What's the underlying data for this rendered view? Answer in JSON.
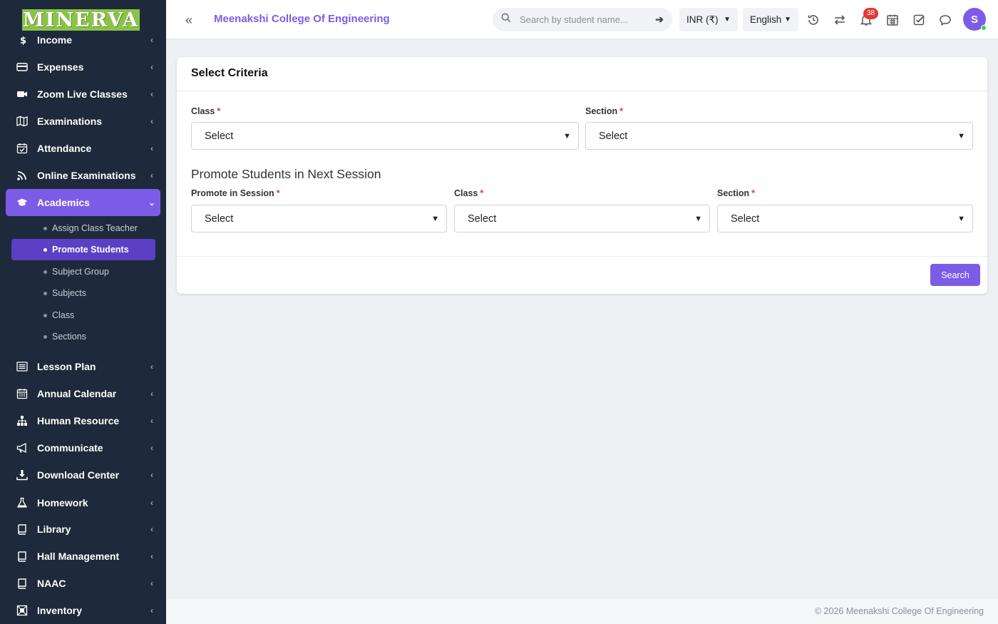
{
  "brand": {
    "logo_text": "MINERVA"
  },
  "sidebar": {
    "partial_top_item": "Income",
    "items_top": [
      {
        "label": "Expenses",
        "icon": "credit-card-icon"
      },
      {
        "label": "Zoom Live Classes",
        "icon": "video-icon"
      },
      {
        "label": "Examinations",
        "icon": "map-icon"
      },
      {
        "label": "Attendance",
        "icon": "calendar-check-icon"
      },
      {
        "label": "Online Examinations",
        "icon": "rss-icon"
      }
    ],
    "active_item": {
      "label": "Academics",
      "icon": "graduation-cap-icon"
    },
    "sub_items": [
      {
        "label": "Assign Class Teacher"
      },
      {
        "label": "Promote Students"
      },
      {
        "label": "Subject Group"
      },
      {
        "label": "Subjects"
      },
      {
        "label": "Class"
      },
      {
        "label": "Sections"
      }
    ],
    "items_bottom": [
      {
        "label": "Lesson Plan",
        "icon": "list-icon"
      },
      {
        "label": "Annual Calendar",
        "icon": "calendar-icon"
      },
      {
        "label": "Human Resource",
        "icon": "sitemap-icon"
      },
      {
        "label": "Communicate",
        "icon": "bullhorn-icon"
      },
      {
        "label": "Download Center",
        "icon": "download-icon"
      },
      {
        "label": "Homework",
        "icon": "flask-icon"
      },
      {
        "label": "Library",
        "icon": "book-icon"
      },
      {
        "label": "Hall Management",
        "icon": "book-icon"
      },
      {
        "label": "NAAC",
        "icon": "book-icon"
      },
      {
        "label": "Inventory",
        "icon": "inventory-icon"
      }
    ]
  },
  "header": {
    "college_name": "Meenakshi College Of Engineering",
    "search_placeholder": "Search by student name...",
    "currency": "INR (₹)",
    "language": "English",
    "notification_count": "38",
    "avatar_initial": "S"
  },
  "card": {
    "title": "Select Criteria",
    "class_label": "Class",
    "section_label": "Section",
    "class_value": "Select",
    "section_value": "Select",
    "promote_heading": "Promote Students in Next Session",
    "promote_session_label": "Promote in Session",
    "promote_class_label": "Class",
    "promote_section_label": "Section",
    "promote_session_value": "Select",
    "promote_class_value": "Select",
    "promote_section_value": "Select",
    "required_mark": "*",
    "search_button": "Search"
  },
  "footer": {
    "copyright": "© 2026 Meenakshi College Of Engineering"
  },
  "colors": {
    "accent": "#7c5ce6",
    "sidebar_bg": "#1e2a3b",
    "active_sub": "#5b3fc4",
    "badge": "#e53935"
  }
}
